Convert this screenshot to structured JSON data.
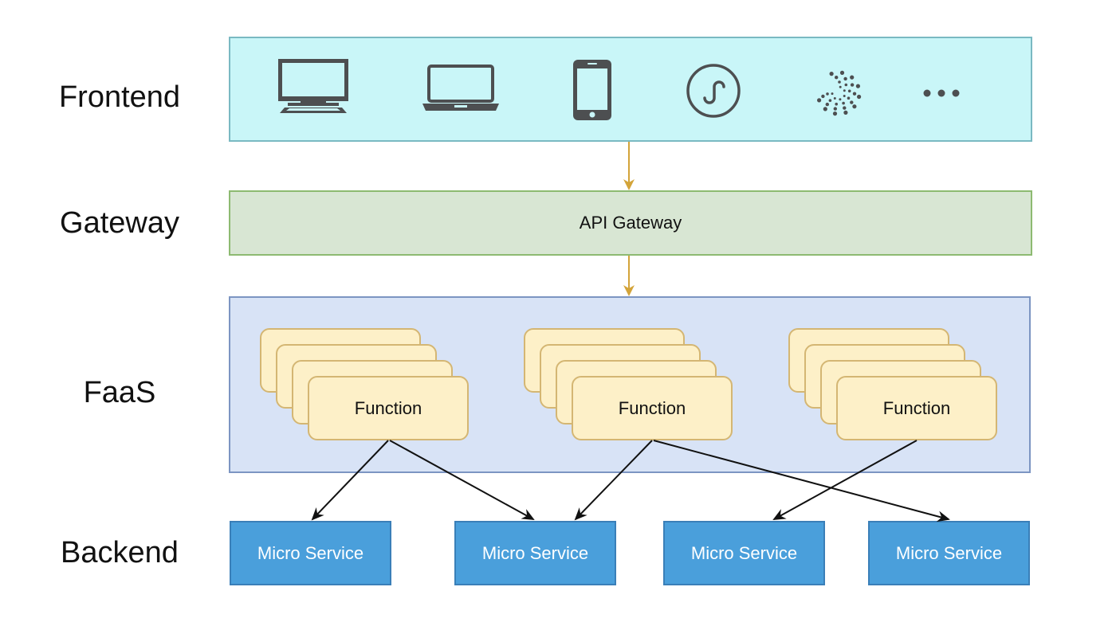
{
  "layers": {
    "frontend": {
      "label": "Frontend",
      "clients": [
        {
          "icon": "desktop-monitor-icon"
        },
        {
          "icon": "laptop-icon"
        },
        {
          "icon": "smartphone-icon"
        },
        {
          "icon": "mini-program-icon"
        },
        {
          "icon": "iot-icon"
        },
        {
          "icon": "more-ellipsis-icon"
        }
      ]
    },
    "gateway": {
      "label": "Gateway",
      "box_label": "API Gateway"
    },
    "faas": {
      "label": "FaaS",
      "function_groups": [
        {
          "label": "Function",
          "stack_depth": 4
        },
        {
          "label": "Function",
          "stack_depth": 4
        },
        {
          "label": "Function",
          "stack_depth": 4
        }
      ]
    },
    "backend": {
      "label": "Backend",
      "services": [
        {
          "label": "Micro Service"
        },
        {
          "label": "Micro Service"
        },
        {
          "label": "Micro Service"
        },
        {
          "label": "Micro Service"
        }
      ]
    }
  },
  "edges": [
    {
      "from": "frontend",
      "to": "gateway"
    },
    {
      "from": "gateway",
      "to": "faas"
    },
    {
      "from": "function-1",
      "to": "micro-service-1"
    },
    {
      "from": "function-1",
      "to": "micro-service-2"
    },
    {
      "from": "function-2",
      "to": "micro-service-2"
    },
    {
      "from": "function-2",
      "to": "micro-service-4"
    },
    {
      "from": "function-3",
      "to": "micro-service-3"
    }
  ],
  "colors": {
    "frontend_fill": "#c9f6f8",
    "gateway_fill": "#d8e6d3",
    "faas_fill": "#d8e3f6",
    "function_fill": "#fdf0c8",
    "service_fill": "#4a9fdb",
    "gateway_arrow": "#d3a43a",
    "icon": "#4d4f51"
  }
}
